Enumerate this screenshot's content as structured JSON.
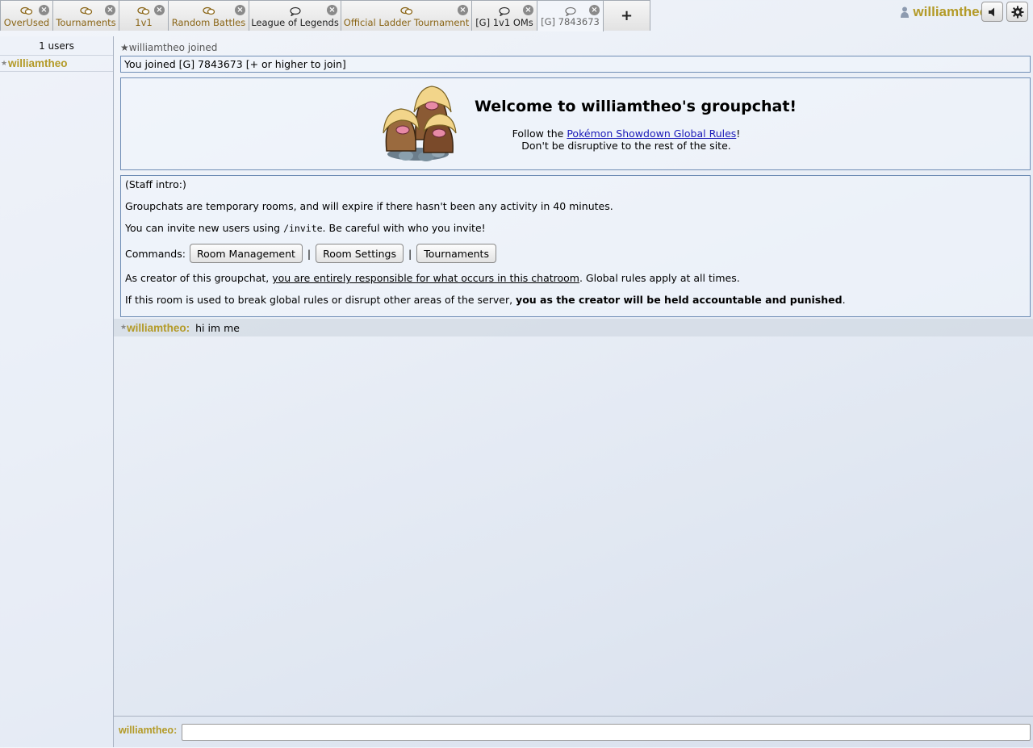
{
  "tabs": [
    {
      "label": "OverUsed",
      "icon": "chat-bubbles-icon",
      "closable": true
    },
    {
      "label": "Tournaments",
      "icon": "chat-bubbles-icon",
      "closable": true
    },
    {
      "label": "1v1",
      "icon": "chat-bubbles-icon",
      "closable": true
    },
    {
      "label": "Random Battles",
      "icon": "chat-bubbles-icon",
      "closable": true
    },
    {
      "label": "League of Legends",
      "icon": "chat-bubble-outline-icon",
      "closable": true
    },
    {
      "label": "Official Ladder Tournament",
      "icon": "chat-bubbles-icon",
      "closable": true
    },
    {
      "label": "[G] 1v1 OMs",
      "icon": "chat-bubble-outline-icon",
      "closable": true
    },
    {
      "label": "[G] 7843673",
      "icon": "chat-bubble-outline-icon",
      "closable": true,
      "active": true
    }
  ],
  "new_tab_label": "+",
  "header": {
    "username": "williamtheo",
    "accent_color": "#b39a27"
  },
  "sidebar": {
    "user_count": "1 users",
    "users": [
      {
        "rank": "★",
        "name": "williamtheo"
      }
    ]
  },
  "chat": {
    "join_notice": "★williamtheo joined",
    "joined_message": "You joined [G] 7843673 [+ or higher to join]",
    "welcome": {
      "title": "Welcome to williamtheo's groupchat!",
      "follow_prefix": "Follow the ",
      "rules_link": "Pokémon Showdown Global Rules",
      "follow_suffix": "!",
      "line2": "Don't be disruptive to the rest of the site."
    },
    "staff": {
      "intro": "(Staff intro:)",
      "line1": "Groupchats are temporary rooms, and will expire if there hasn't been any activity in 40 minutes.",
      "invite_prefix": "You can invite new users using ",
      "invite_cmd": "/invite",
      "invite_suffix": ". Be careful with who you invite!",
      "commands_label": "Commands:",
      "buttons": [
        "Room Management",
        "Room Settings",
        "Tournaments"
      ],
      "separator": "|",
      "creator_prefix": "As creator of this groupchat, ",
      "creator_underline": "you are entirely responsible for what occurs in this chatroom",
      "creator_suffix": ". Global rules apply at all times.",
      "abuse_prefix": "If this room is used to break global rules or disrupt other areas of the server, ",
      "abuse_bold": "you as the creator will be held accountable and punished",
      "abuse_suffix": "."
    },
    "messages": [
      {
        "rank": "★",
        "author": "williamtheo:",
        "text": "hi im me"
      }
    ]
  },
  "input": {
    "prompt": "williamtheo:",
    "value": ""
  }
}
